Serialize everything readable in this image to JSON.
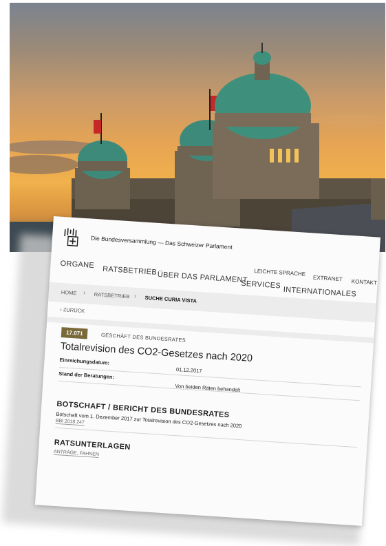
{
  "site": {
    "title": "Die Bundesversammlung — Das Schweizer Parlament"
  },
  "main_nav": [
    "ORGANE",
    "RATSBETRIEB",
    "ÜBER DAS PARLAMENT",
    "SERVICES",
    "INTERNATIONALES"
  ],
  "top_nav": [
    "LEICHTE SPRACHE",
    "EXTRANET",
    "KONTAKT"
  ],
  "breadcrumb": [
    "HOME",
    "RATSBETRIEB",
    "SUCHE CURIA VISTA"
  ],
  "back": {
    "label": "ZURÜCK"
  },
  "business": {
    "number": "17.071",
    "type": "GESCHÄFT DES BUNDESRATES",
    "title": "Totalrevision des CO2-Gesetzes nach 2020",
    "fields": [
      {
        "label": "Einreichungsdatum:",
        "value": "01.12.2017"
      },
      {
        "label": "Stand der Beratungen:",
        "value": "Von beiden Räten behandelt"
      }
    ]
  },
  "botschaft": {
    "heading": "BOTSCHAFT / BERICHT DES BUNDESRATES",
    "text": "Botschaft vom 1. Dezember 2017 zur Totalrevision des CO2-Gesetzes nach 2020",
    "link": "BBl 2018 247"
  },
  "ratsunterlagen": {
    "heading": "RATSUNTERLAGEN",
    "link": "ANTRÄGE, FAHNEN"
  },
  "colors": {
    "badge": "#7a6a3a",
    "breadcrumb_bg": "#ececec",
    "sky": "#f1b14c",
    "dome": "#3e8a7a"
  }
}
